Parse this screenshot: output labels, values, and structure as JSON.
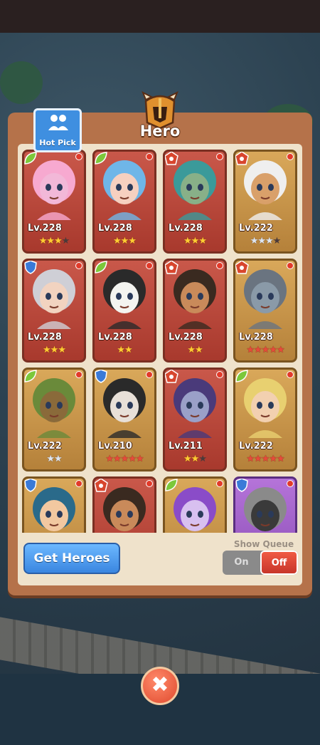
{
  "title": "Hero",
  "hot_pick_label": "Hot Pick",
  "heroes": [
    {
      "level": "Lv.228",
      "stars": [
        [
          "gold",
          3
        ],
        [
          "dark",
          1
        ]
      ],
      "faction": "leaf",
      "frame": "red",
      "skin": "#f2b8d8",
      "hair": "#f7a9d0"
    },
    {
      "level": "Lv.228",
      "stars": [
        [
          "gold",
          3
        ]
      ],
      "faction": "leaf",
      "frame": "red",
      "skin": "#f6d0c0",
      "hair": "#6fb6e8"
    },
    {
      "level": "Lv.228",
      "stars": [
        [
          "gold",
          3
        ]
      ],
      "faction": "demon",
      "frame": "red",
      "skin": "#88b088",
      "hair": "#3b9a9a"
    },
    {
      "level": "Lv.222",
      "stars": [
        [
          "silver",
          3
        ],
        [
          "dark",
          1
        ]
      ],
      "faction": "demon",
      "frame": "gold",
      "skin": "#d9a06a",
      "hair": "#efefef"
    },
    {
      "level": "Lv.228",
      "stars": [
        [
          "gold",
          3
        ]
      ],
      "faction": "shield",
      "frame": "red",
      "skin": "#f2d3c0",
      "hair": "#cfcfd6"
    },
    {
      "level": "Lv.228",
      "stars": [
        [
          "gold",
          2
        ]
      ],
      "faction": "leaf",
      "frame": "red",
      "skin": "#f4f4f0",
      "hair": "#2a2a2a"
    },
    {
      "level": "Lv.228",
      "stars": [
        [
          "gold",
          2
        ]
      ],
      "faction": "demon",
      "frame": "red",
      "skin": "#c98a5a",
      "hair": "#3a2a20"
    },
    {
      "level": "Lv.228",
      "stars": [
        [
          "red",
          5
        ]
      ],
      "faction": "demon",
      "frame": "gold",
      "skin": "#8a9aa8",
      "hair": "#6a7480"
    },
    {
      "level": "Lv.222",
      "stars": [
        [
          "silver",
          2
        ]
      ],
      "faction": "leaf",
      "frame": "gold",
      "skin": "#8a6a3a",
      "hair": "#6a8a3a"
    },
    {
      "level": "Lv.210",
      "stars": [
        [
          "red",
          5
        ]
      ],
      "faction": "shield",
      "frame": "gold",
      "skin": "#e8e0d8",
      "hair": "#2a2a2a"
    },
    {
      "level": "Lv.211",
      "stars": [
        [
          "gold",
          2
        ],
        [
          "dark",
          1
        ]
      ],
      "faction": "demon",
      "frame": "red",
      "skin": "#9aa0c8",
      "hair": "#4a3a7a"
    },
    {
      "level": "Lv.222",
      "stars": [
        [
          "red",
          5
        ]
      ],
      "faction": "leaf",
      "frame": "gold",
      "skin": "#f2d0b0",
      "hair": "#e8d070"
    },
    {
      "level": "",
      "stars": [],
      "faction": "shield",
      "frame": "gold",
      "skin": "#f2c8a0",
      "hair": "#2a6a8a"
    },
    {
      "level": "",
      "stars": [],
      "faction": "demon",
      "frame": "red",
      "skin": "#c98a5a",
      "hair": "#3a2a20"
    },
    {
      "level": "",
      "stars": [],
      "faction": "leaf",
      "frame": "gold",
      "skin": "#d8c0f0",
      "hair": "#8a4cc8"
    },
    {
      "level": "",
      "stars": [],
      "faction": "shield",
      "frame": "purple",
      "skin": "#3a3a3a",
      "hair": "#8a8a8a"
    }
  ],
  "get_heroes_label": "Get Heroes",
  "show_queue_label": "Show Queue",
  "toggle_on_label": "On",
  "toggle_off_label": "Off",
  "close_symbol": "✖",
  "accent_colors": {
    "panel": "#b5724a",
    "panel_inner": "#efe2cb",
    "button_blue": "#3a86e0",
    "toggle_active": "#e04a2e"
  }
}
